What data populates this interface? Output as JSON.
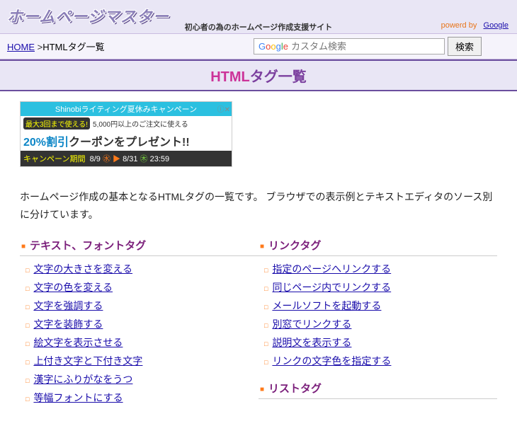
{
  "header": {
    "logo": "ホームページマスター",
    "tagline": "初心者の為のホームページ作成支援サイト",
    "powered_prefix": "powerd by",
    "powered_link": "Google"
  },
  "breadcrumb": {
    "home": "HOME",
    "sep": " >",
    "current": "HTMLタグ一覧"
  },
  "search": {
    "placeholder": "カスタム検索",
    "button": "検索"
  },
  "page_title": {
    "accent": "HTML",
    "rest": "タグ一覧"
  },
  "ad": {
    "top": "Shinobiライティング夏休みキャンペーン",
    "badge": "最大3回まで使える!",
    "sub": "5,000円以上のご注文に使える",
    "pct": "20%割引",
    "main_rest": "クーポンをプレゼント!!",
    "label": "キャンペーン期間",
    "d1": "8/9",
    "d1c": "㊌",
    "arrow": "▶",
    "d2": "8/31",
    "d2c": "㊍",
    "time": "23:59"
  },
  "intro": "ホームページ作成の基本となるHTMLタグの一覧です。 ブラウザでの表示例とテキストエディタのソース別に分けています。",
  "left": {
    "heading": "テキスト、フォントタグ",
    "items": [
      "文字の大きさを変える",
      "文字の色を変える",
      "文字を強調する",
      "文字を装飾する",
      "絵文字を表示させる",
      "上付き文字と下付き文字",
      "漢字にふりがなをうつ",
      "等幅フォントにする"
    ]
  },
  "right": {
    "heading1": "リンクタグ",
    "items": [
      "指定のページへリンクする",
      "同じページ内でリンクする",
      "メールソフトを起動する",
      "別窓でリンクする",
      "説明文を表示する",
      "リンクの文字色を指定する"
    ],
    "heading2": "リストタグ"
  }
}
